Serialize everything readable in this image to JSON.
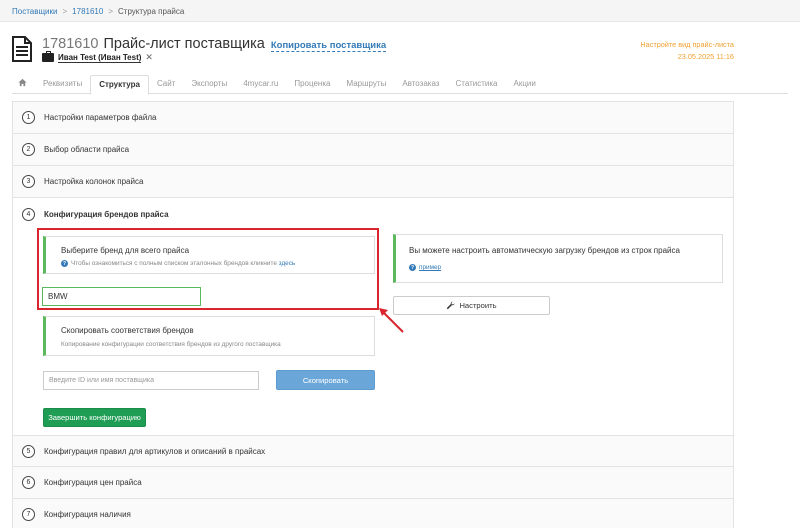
{
  "breadcrumb": {
    "item1": "Поставщики",
    "item2": "1781610",
    "current": "Структура прайса",
    "sep": ">"
  },
  "header": {
    "id": "1781610",
    "title": "Прайс-лист поставщика",
    "copy_link": "Копировать поставщика",
    "owner": "Иван Test (Иван Test)",
    "close": "✕",
    "right_link": "Настройте вид прайс-листа",
    "right_date": "23.05.2025  11:16"
  },
  "tabs": [
    {
      "label": "Реквизиты"
    },
    {
      "label": "Структура"
    },
    {
      "label": "Сайт"
    },
    {
      "label": "Экспорты"
    },
    {
      "label": "4mycar.ru"
    },
    {
      "label": "Проценка"
    },
    {
      "label": "Маршруты"
    },
    {
      "label": "Автозаказ"
    },
    {
      "label": "Статистика"
    },
    {
      "label": "Акции"
    }
  ],
  "steps": [
    {
      "num": "1",
      "label": "Настройки параметров файла"
    },
    {
      "num": "2",
      "label": "Выбор области прайса"
    },
    {
      "num": "3",
      "label": "Настройка колонок прайса"
    },
    {
      "num": "4",
      "label": "Конфигурация брендов прайса"
    },
    {
      "num": "5",
      "label": "Конфигурация правил для артикулов и описаний в прайсах"
    },
    {
      "num": "6",
      "label": "Конфигурация цен прайса"
    },
    {
      "num": "7",
      "label": "Конфигурация наличия"
    }
  ],
  "brand_card": {
    "title": "Выберите бренд для всего прайса",
    "hint": "Чтобы ознакомиться с полным списком эталонных брендов кликните",
    "hint_link": "здесь"
  },
  "brand_input": {
    "value": "BMW"
  },
  "auto_card": {
    "title": "Вы можете настроить автоматическую загрузку брендов из строк прайса",
    "link": "пример"
  },
  "configure_button": "Настроить",
  "copy_card": {
    "title": "Скопировать соответствия брендов",
    "hint": "Копирование конфигурации соответствия брендов из другого поставщика"
  },
  "supplier_input": {
    "placeholder": "Введите ID или имя поставщика"
  },
  "copy_button": "Скопировать",
  "finish_button": "Завершить конфигурацию",
  "colors": {
    "accent": "#337ab7",
    "success": "#1f9d55",
    "highlight": "#d9262e",
    "warning": "#f0a030"
  }
}
